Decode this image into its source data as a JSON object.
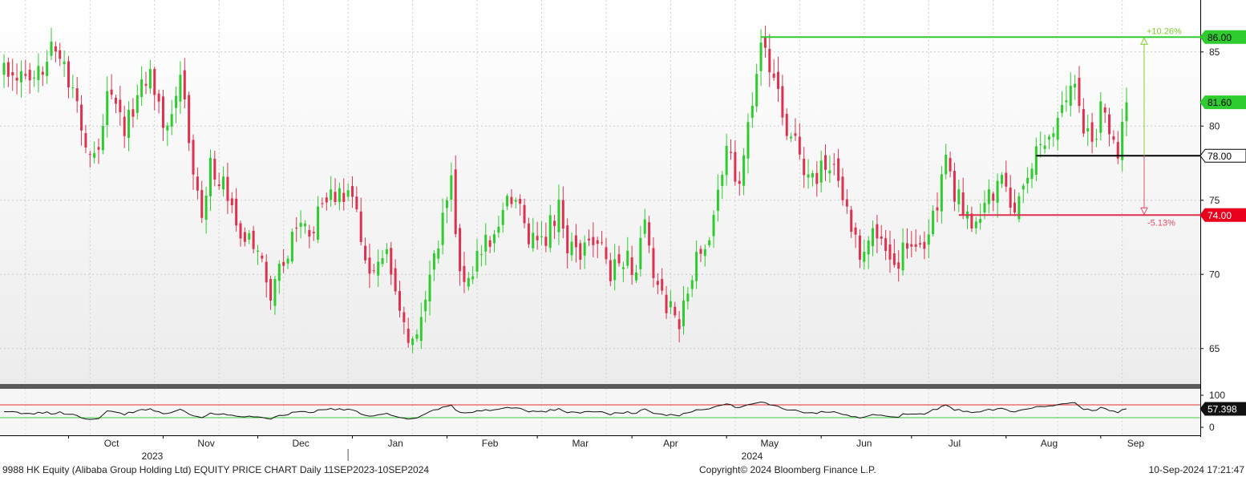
{
  "footer": {
    "title": "9988 HK Equity (Alibaba Group Holding Ltd) EQUITY PRICE CHART  Daily 11SEP2023-10SEP2024",
    "copyright": "Copyright© 2024 Bloomberg Finance L.P.",
    "timestamp": "10-Sep-2024 17:21:47"
  },
  "colors": {
    "up": "#2ecc2e",
    "down": "#dc3250",
    "resistance": "#2ecc2e",
    "support": "#dc3250",
    "pivot": "#000000",
    "rsi_upper": "#e53030",
    "rsi_lower": "#3ccf3c"
  },
  "chart_data": {
    "type": "candlestick",
    "price_axis": {
      "ticks": [
        65,
        70,
        75,
        80,
        85
      ],
      "range": [
        62.5,
        88.5
      ]
    },
    "rsi_axis": {
      "ticks": [
        0,
        100
      ],
      "range": [
        0,
        100
      ]
    },
    "x_axis": {
      "months": [
        "Oct",
        "Nov",
        "Dec",
        "Jan",
        "Feb",
        "Mar",
        "Apr",
        "May",
        "Jun",
        "Jul",
        "Aug",
        "Sep"
      ],
      "years": [
        "2023",
        "2024"
      ]
    },
    "price_labels": {
      "resistance": "86.00",
      "last": "81.60",
      "pivot": "78.00",
      "support": "74.00",
      "rsi_last": "57.398"
    },
    "annotations": {
      "up_pct": "+10.26%",
      "down_pct": "-5.13%"
    },
    "levels": {
      "resistance": 86.0,
      "last": 81.6,
      "pivot": 78.0,
      "support": 74.0,
      "rsi_upper": 70,
      "rsi_lower": 30,
      "rsi_last": 57.398
    },
    "close_anchors": [
      [
        "2023-09-11",
        84.0
      ],
      [
        "2023-09-20",
        82.5
      ],
      [
        "2023-09-26",
        86.0
      ],
      [
        "2023-10-03",
        82.0
      ],
      [
        "2023-10-06",
        79.0
      ],
      [
        "2023-10-10",
        77.5
      ],
      [
        "2023-10-13",
        82.0
      ],
      [
        "2023-10-19",
        80.0
      ],
      [
        "2023-10-24",
        82.0
      ],
      [
        "2023-10-27",
        84.0
      ],
      [
        "2023-11-01",
        80.0
      ],
      [
        "2023-11-03",
        81.5
      ],
      [
        "2023-11-07",
        84.0
      ],
      [
        "2023-11-08",
        81.5
      ],
      [
        "2023-11-10",
        77.0
      ],
      [
        "2023-11-14",
        74.0
      ],
      [
        "2023-11-16",
        77.5
      ],
      [
        "2023-11-21",
        76.0
      ],
      [
        "2023-11-24",
        73.0
      ],
      [
        "2023-11-30",
        72.0
      ],
      [
        "2023-12-06",
        69.0
      ],
      [
        "2023-12-12",
        71.5
      ],
      [
        "2023-12-15",
        74.0
      ],
      [
        "2023-12-19",
        73.0
      ],
      [
        "2023-12-22",
        74.5
      ],
      [
        "2023-12-28",
        76.0
      ],
      [
        "2024-01-03",
        74.0
      ],
      [
        "2024-01-08",
        70.0
      ],
      [
        "2024-01-12",
        71.0
      ],
      [
        "2024-01-17",
        67.0
      ],
      [
        "2024-01-22",
        65.0
      ],
      [
        "2024-01-26",
        70.0
      ],
      [
        "2024-01-30",
        72.0
      ],
      [
        "2024-02-02",
        76.5
      ],
      [
        "2024-02-06",
        70.0
      ],
      [
        "2024-02-09",
        70.5
      ],
      [
        "2024-02-14",
        72.0
      ],
      [
        "2024-02-19",
        73.5
      ],
      [
        "2024-02-23",
        75.5
      ],
      [
        "2024-02-28",
        72.5
      ],
      [
        "2024-03-04",
        72.0
      ],
      [
        "2024-03-08",
        74.5
      ],
      [
        "2024-03-12",
        72.0
      ],
      [
        "2024-03-18",
        71.5
      ],
      [
        "2024-03-21",
        72.5
      ],
      [
        "2024-03-26",
        70.0
      ],
      [
        "2024-03-28",
        71.5
      ],
      [
        "2024-04-03",
        70.5
      ],
      [
        "2024-04-05",
        73.0
      ],
      [
        "2024-04-09",
        70.0
      ],
      [
        "2024-04-12",
        68.0
      ],
      [
        "2024-04-17",
        66.5
      ],
      [
        "2024-04-22",
        70.0
      ],
      [
        "2024-04-26",
        73.0
      ],
      [
        "2024-05-02",
        78.0
      ],
      [
        "2024-05-07",
        76.5
      ],
      [
        "2024-05-10",
        81.0
      ],
      [
        "2024-05-14",
        86.0
      ],
      [
        "2024-05-17",
        83.5
      ],
      [
        "2024-05-21",
        80.0
      ],
      [
        "2024-05-24",
        79.0
      ],
      [
        "2024-05-29",
        76.0
      ],
      [
        "2024-06-03",
        77.0
      ],
      [
        "2024-06-06",
        77.5
      ],
      [
        "2024-06-11",
        74.0
      ],
      [
        "2024-06-14",
        71.5
      ],
      [
        "2024-06-19",
        73.5
      ],
      [
        "2024-06-24",
        72.0
      ],
      [
        "2024-06-27",
        71.0
      ],
      [
        "2024-07-02",
        72.5
      ],
      [
        "2024-07-05",
        72.0
      ],
      [
        "2024-07-10",
        74.5
      ],
      [
        "2024-07-12",
        77.5
      ],
      [
        "2024-07-16",
        75.5
      ],
      [
        "2024-07-19",
        74.0
      ],
      [
        "2024-07-23",
        73.5
      ],
      [
        "2024-07-26",
        75.0
      ],
      [
        "2024-07-31",
        76.5
      ],
      [
        "2024-08-05",
        74.5
      ],
      [
        "2024-08-08",
        76.0
      ],
      [
        "2024-08-12",
        78.0
      ],
      [
        "2024-08-15",
        79.5
      ],
      [
        "2024-08-20",
        81.5
      ],
      [
        "2024-08-22",
        83.5
      ],
      [
        "2024-08-27",
        80.0
      ],
      [
        "2024-08-29",
        78.5
      ],
      [
        "2024-09-02",
        81.0
      ],
      [
        "2024-09-05",
        79.0
      ],
      [
        "2024-09-06",
        78.0
      ],
      [
        "2024-09-09",
        79.5
      ],
      [
        "2024-09-10",
        81.6
      ]
    ]
  }
}
